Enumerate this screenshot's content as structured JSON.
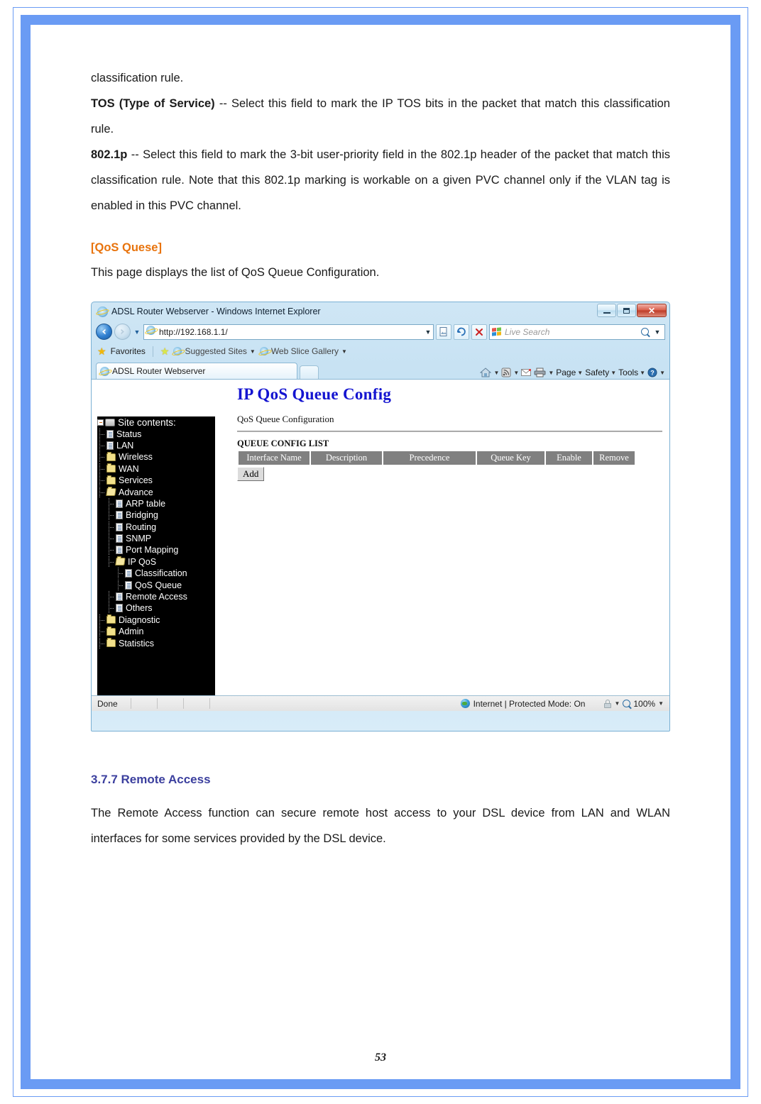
{
  "document": {
    "paragraphs": [
      {
        "id": "p1",
        "html": "classification rule."
      },
      {
        "id": "p2",
        "bold_lead": "TOS (Type of Service)",
        "rest": " -- Select this field to mark the IP TOS bits in the packet that match this classification rule."
      },
      {
        "id": "p3",
        "bold_lead": "802.1p",
        "rest": " -- Select this field to mark the 3-bit user-priority field in the 802.1p header of the packet that match this classification rule. Note that this 802.1p marking is workable on a given PVC channel only if the VLAN tag is enabled in this PVC channel."
      }
    ],
    "section_qos_heading": "[QoS Quese]",
    "section_qos_intro": "This page displays the list of QoS Queue Configuration.",
    "section_remote_heading": "3.7.7 Remote Access",
    "section_remote_body": "The Remote Access function can secure remote host access to your DSL device from LAN and WLAN interfaces for some services provided by the DSL device.",
    "page_number": "53",
    "colors": {
      "frame_blue": "#6a9bf4",
      "heading_orange": "#e8730c",
      "heading_blue": "#3b3f9e"
    }
  },
  "browser": {
    "title": "ADSL Router Webserver - Windows Internet Explorer",
    "window_buttons": {
      "minimize": "minimize-icon",
      "maximize": "maximize-icon",
      "close": "✕"
    },
    "address": {
      "url": "http://192.168.1.1/",
      "back_glyph": "◄",
      "forward_glyph": "►",
      "recent_caret": "▼",
      "compat_label": "compatibility-view-icon",
      "refresh_glyph": "↻",
      "stop_glyph": "✕"
    },
    "search": {
      "placeholder": "Live Search",
      "magnifier": "search-icon",
      "caret": "▼"
    },
    "favorites_bar": {
      "favorites_label": "Favorites",
      "items": [
        {
          "label": "Suggested Sites",
          "caret": "▼"
        },
        {
          "label": "Web Slice Gallery",
          "caret": "▼"
        }
      ]
    },
    "tab": {
      "label": "ADSL Router Webserver"
    },
    "command_bar": [
      {
        "label": "",
        "icon": "home-icon",
        "caret": "▼"
      },
      {
        "label": "",
        "icon": "feeds-icon",
        "caret": "▼"
      },
      {
        "label": "",
        "icon": "mail-icon",
        "caret": ""
      },
      {
        "label": "",
        "icon": "print-icon",
        "caret": "▼"
      },
      {
        "label": "Page",
        "icon": "",
        "caret": "▼"
      },
      {
        "label": "Safety",
        "icon": "",
        "caret": "▼"
      },
      {
        "label": "Tools",
        "icon": "",
        "caret": "▼"
      },
      {
        "label": "",
        "icon": "help-icon",
        "caret": "▼"
      }
    ],
    "status_bar": {
      "left": "Done",
      "zone": "Internet | Protected Mode: On",
      "zoom": "100%",
      "zone_caret": "▼",
      "zoom_caret": "▼"
    }
  },
  "router_ui": {
    "sidebar": {
      "root_label": "Site contents:",
      "items": [
        {
          "label": "Status",
          "icon": "page-icon",
          "level": 1
        },
        {
          "label": "LAN",
          "icon": "page-icon",
          "level": 1
        },
        {
          "label": "Wireless",
          "icon": "folder-icon",
          "level": 1
        },
        {
          "label": "WAN",
          "icon": "folder-icon",
          "level": 1
        },
        {
          "label": "Services",
          "icon": "folder-icon",
          "level": 1
        },
        {
          "label": "Advance",
          "icon": "folder-open-icon",
          "level": 1
        },
        {
          "label": "ARP table",
          "icon": "page-icon",
          "level": 2
        },
        {
          "label": "Bridging",
          "icon": "page-icon",
          "level": 2
        },
        {
          "label": "Routing",
          "icon": "page-icon",
          "level": 2
        },
        {
          "label": "SNMP",
          "icon": "page-icon",
          "level": 2
        },
        {
          "label": "Port Mapping",
          "icon": "page-icon",
          "level": 2
        },
        {
          "label": "IP QoS",
          "icon": "folder-open-icon",
          "level": 2
        },
        {
          "label": "Classification",
          "icon": "page-icon",
          "level": 3
        },
        {
          "label": "QoS Queue",
          "icon": "page-icon",
          "level": 3
        },
        {
          "label": "Remote Access",
          "icon": "page-icon",
          "level": 2
        },
        {
          "label": "Others",
          "icon": "page-icon",
          "level": 2
        },
        {
          "label": "Diagnostic",
          "icon": "folder-icon",
          "level": 1
        },
        {
          "label": "Admin",
          "icon": "folder-icon",
          "level": 1
        },
        {
          "label": "Statistics",
          "icon": "folder-icon",
          "level": 1
        }
      ]
    },
    "content": {
      "title": "IP QoS Queue Config",
      "subtitle": "QoS Queue Configuration",
      "list_label": "QUEUE CONFIG LIST",
      "table_headers": [
        "Interface Name",
        "Description",
        "Precedence",
        "Queue Key",
        "Enable",
        "Remove"
      ],
      "table_rows": [],
      "add_button": "Add",
      "title_color": "#1414d0",
      "header_bg": "#808080"
    }
  }
}
